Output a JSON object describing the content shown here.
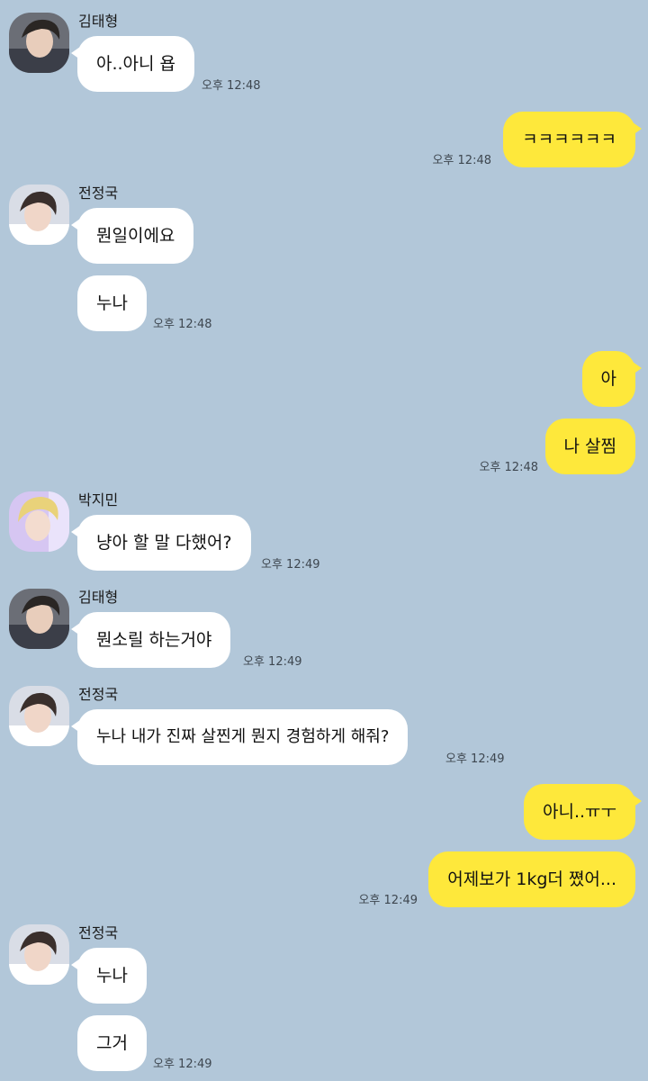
{
  "messages": [
    {
      "sender": "김태형",
      "avatar": "avatar-taehyung",
      "text": "아..아니 욥",
      "time": "오후 12:48"
    },
    {
      "me": true,
      "text": "ㅋㅋㅋㅋㅋㅋ",
      "time": "오후 12:48"
    },
    {
      "sender": "전정국",
      "avatar": "avatar-jungkook",
      "texts": [
        "뭔일이에요",
        "누나"
      ],
      "time": "오후 12:48"
    },
    {
      "me": true,
      "texts": [
        "아",
        "나 살찜"
      ],
      "time": "오후 12:48"
    },
    {
      "sender": "박지민",
      "avatar": "avatar-jimin",
      "text": "냥아 할 말 다했어?",
      "time": "오후 12:49"
    },
    {
      "sender": "김태형",
      "avatar": "avatar-taehyung",
      "text": "뭔소릴 하는거야",
      "time": "오후 12:49"
    },
    {
      "sender": "전정국",
      "avatar": "avatar-jungkook",
      "text": "누나 내가 진짜 살찐게 뭔지 경험하게 해줘?",
      "time": "오후 12:49"
    },
    {
      "me": true,
      "texts": [
        "아니..ㅠㅜ",
        "어제보가 1kg더 쪘어..."
      ],
      "time": "오후 12:49"
    },
    {
      "sender": "전정국",
      "avatar": "avatar-jungkook",
      "texts": [
        "누나",
        "그거"
      ],
      "time": "오후 12:49"
    }
  ],
  "colors": {
    "background": "#b2c7d9",
    "bubble_in": "#ffffff",
    "bubble_out": "#fee83b"
  }
}
